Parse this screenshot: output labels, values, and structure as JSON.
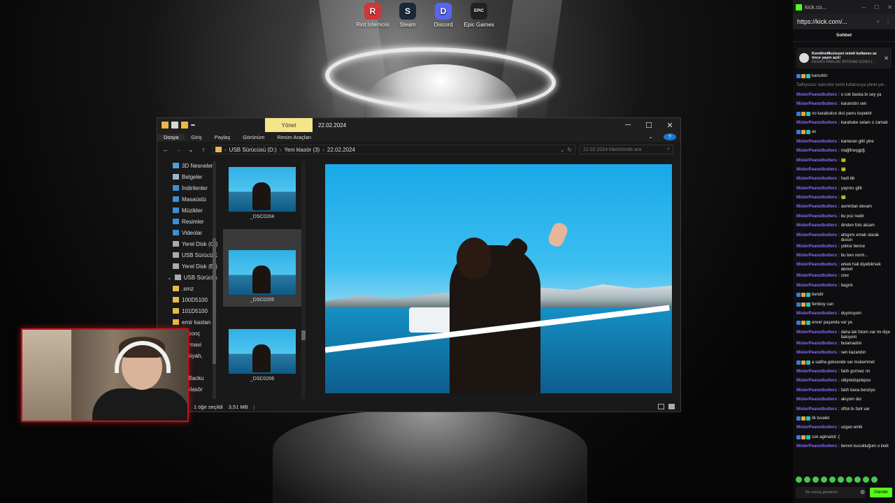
{
  "desktop": {
    "icons": [
      {
        "label": "Riot İstemcisi",
        "color": "#d13639",
        "glyph": "R"
      },
      {
        "label": "Steam",
        "color": "#1b2838",
        "glyph": "S"
      },
      {
        "label": "Discord",
        "color": "#5865f2",
        "glyph": "D"
      },
      {
        "label": "Epic Games",
        "color": "#222222",
        "glyph": "EPIC"
      }
    ]
  },
  "explorer": {
    "manage_tab": "Yönet",
    "title": "22.02.2024",
    "ribbon_tabs": [
      "Dosya",
      "Giriş",
      "Paylaş",
      "Görünüm",
      "Resim Araçları"
    ],
    "breadcrumb": [
      "USB Sürücüsü (D:)",
      "Yeni klasör (3)",
      "22.02.2024"
    ],
    "search_placeholder": "22.02.2024 klasöründe ara",
    "nav_items": [
      {
        "label": "3D Nesneler",
        "icon": "cube-icon",
        "color": "#4aa3df"
      },
      {
        "label": "Belgeler",
        "icon": "documents-icon",
        "color": "#9fb6c9"
      },
      {
        "label": "İndirilenler",
        "icon": "downloads-icon",
        "color": "#3c8fd8"
      },
      {
        "label": "Masaüstü",
        "icon": "desktop-icon",
        "color": "#3c8fd8"
      },
      {
        "label": "Müzikler",
        "icon": "music-icon",
        "color": "#3c8fd8"
      },
      {
        "label": "Resimler",
        "icon": "pictures-icon",
        "color": "#3c8fd8"
      },
      {
        "label": "Videolar",
        "icon": "videos-icon",
        "color": "#3c8fd8"
      },
      {
        "label": "Yerel Disk (C:)",
        "icon": "disk-icon",
        "color": "#aaaaaa"
      },
      {
        "label": "USB Sürücüsü",
        "icon": "usb-icon",
        "color": "#aaaaaa"
      },
      {
        "label": "Yerel Disk (E:)",
        "icon": "disk-icon",
        "color": "#aaaaaa"
      }
    ],
    "nav_drive": "USB Sürücüsü",
    "nav_folders": [
      ".smz",
      "100D5100",
      "101D5100",
      "emir kastan",
      "oooooç",
      "up mavi",
      "upsiyah,",
      "o",
      "IZ Backu",
      "ni klasör"
    ],
    "thumbnails": [
      {
        "name": "_DSC0204",
        "selected": false
      },
      {
        "name": "_DSC0205",
        "selected": true
      },
      {
        "name": "_DSC0206",
        "selected": false
      }
    ],
    "status": {
      "selection": "1 öğe seçildi",
      "size": "3,51 MB"
    }
  },
  "browser": {
    "tab_title": "kick.co...",
    "url": "https://kick.com/...",
    "chat_title": "Sohbet",
    "notice": {
      "title": "KendineMuzisyen isimli kullanıcı az önce yayın açtı!",
      "subtitle": "KENAN PARLAK İNTİKAM GÜNÜ |..."
    },
    "input_placeholder": "Bir mesaj gönderin",
    "send_label": "Gönder"
  },
  "chat": [
    {
      "user": "",
      "text": "kancıktır",
      "badges": true,
      "color": "#e8323c"
    },
    {
      "user": "",
      "text": "Tallhyucos: kancıktır isimli kullanıcıya yönel yor...",
      "badges": false,
      "color": "#888888"
    },
    {
      "user": "MisterPeanutbutters",
      "text": "o cok baska bı sey ya",
      "badges": false,
      "color": "#8b6cff"
    },
    {
      "user": "MisterPeanutbutters",
      "text": "karatırdın sen",
      "badges": false,
      "color": "#8b6cff"
    },
    {
      "user": "",
      "text": "no karabukce dısi yavru kopektir",
      "badges": true,
      "color": "#e8323c"
    },
    {
      "user": "MisterPeanutbutters",
      "text": "karabuke selam o zamab",
      "badges": false,
      "color": "#8b6cff"
    },
    {
      "user": "",
      "text": "as",
      "badges": true,
      "color": "#e8323c"
    },
    {
      "user": "MisterPeanutbutters",
      "text": "kameran gitti yine",
      "badges": false,
      "color": "#8b6cff"
    },
    {
      "user": "MisterPeanutbutters",
      "text": "mağfirwşgpğ",
      "badges": false,
      "color": "#8b6cff"
    },
    {
      "user": "MisterPeanutbutters",
      "text": "🐸",
      "badges": false,
      "color": "#8b6cff"
    },
    {
      "user": "MisterPeanutbutters",
      "text": "🐸",
      "badges": false,
      "color": "#8b6cff"
    },
    {
      "user": "MisterPeanutbutters",
      "text": "hadi bb",
      "badges": false,
      "color": "#8b6cff"
    },
    {
      "user": "MisterPeanutbutters",
      "text": "yayıncı gitti",
      "badges": false,
      "color": "#8b6cff"
    },
    {
      "user": "MisterPeanutbutters",
      "text": "🐸",
      "badges": false,
      "color": "#8b6cff"
    },
    {
      "user": "MisterPeanutbutters",
      "text": "asmirdan devam",
      "badges": false,
      "color": "#8b6cff"
    },
    {
      "user": "MisterPeanutbutters",
      "text": "bu poz nedir",
      "badges": false,
      "color": "#8b6cff"
    },
    {
      "user": "MisterPeanutbutters",
      "text": "dmden foto atcam",
      "badges": false,
      "color": "#8b6cff"
    },
    {
      "user": "MisterPeanutbutters",
      "text": "attıgımı emek olarak dusun",
      "badges": false,
      "color": "#8b6cff"
    },
    {
      "user": "MisterPeanutbutters",
      "text": "yoktur bence",
      "badges": false,
      "color": "#8b6cff"
    },
    {
      "user": "MisterPeanutbutters",
      "text": "bu ben norm...",
      "badges": false,
      "color": "#8b6cff"
    },
    {
      "user": "MisterPeanutbutters",
      "text": "erkek hali diyebilirsek demet",
      "badges": false,
      "color": "#8b6cff"
    },
    {
      "user": "MisterPeanutbutters",
      "text": "crex",
      "badges": false,
      "color": "#8b6cff"
    },
    {
      "user": "MisterPeanutbutters",
      "text": "bagırtı",
      "badges": false,
      "color": "#8b6cff"
    },
    {
      "user": "",
      "text": "bendir",
      "badges": true,
      "color": "#e8323c"
    },
    {
      "user": "",
      "text": "femboy can",
      "badges": true,
      "color": "#e8323c"
    },
    {
      "user": "MisterPeanutbutters",
      "text": "duymuyom",
      "badges": false,
      "color": "#8b6cff"
    },
    {
      "user": "",
      "text": "enver paşanda var ya",
      "badges": true,
      "color": "#e8323c"
    },
    {
      "user": "MisterPeanutbutters",
      "text": "daha lak fotom var mı diye bakıyom",
      "badges": false,
      "color": "#8b6cff"
    },
    {
      "user": "MisterPeanutbutters",
      "text": "bulamadım",
      "badges": false,
      "color": "#8b6cff"
    },
    {
      "user": "MisterPeanutbutters",
      "text": "sen kazandın",
      "badges": false,
      "color": "#8b6cff"
    },
    {
      "user": "",
      "text": "a satiha gokcende var mukemmel",
      "badges": true,
      "color": "#e8323c"
    },
    {
      "user": "MisterPeanutbutters",
      "text": "fatıh gormez mı",
      "badges": false,
      "color": "#8b6cff"
    },
    {
      "user": "MisterPeanutbutters",
      "text": "sldyvkdspokpso",
      "badges": false,
      "color": "#8b6cff"
    },
    {
      "user": "MisterPeanutbutters",
      "text": "fatıh bana benziyo",
      "badges": false,
      "color": "#8b6cff"
    },
    {
      "user": "MisterPeanutbutters",
      "text": "akıyom dur",
      "badges": false,
      "color": "#8b6cff"
    },
    {
      "user": "MisterPeanutbutters",
      "text": "oftsk bı fark var",
      "badges": false,
      "color": "#8b6cff"
    },
    {
      "user": "",
      "text": "ilk tuvalet",
      "badges": true,
      "color": "#e8323c"
    },
    {
      "user": "MisterPeanutbutters",
      "text": "uzgan emik",
      "badges": false,
      "color": "#8b6cff"
    },
    {
      "user": "",
      "text": "cok agimalsti :(",
      "badges": true,
      "color": "#e8323c"
    },
    {
      "user": "MisterPeanutbutters",
      "text": "benım kucukluğum o kedi",
      "badges": false,
      "color": "#8b6cff"
    }
  ]
}
